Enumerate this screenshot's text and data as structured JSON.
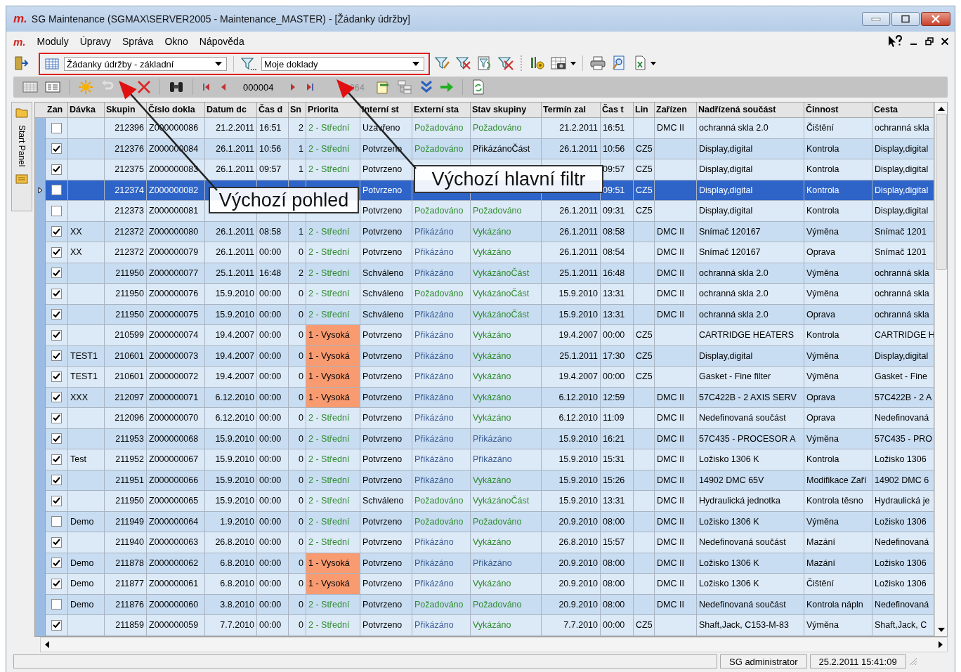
{
  "window": {
    "logo": "m.",
    "title": "SG Maintenance (SGMAX\\SERVER2005 - Maintenance_MASTER) - [Žádanky údržby]"
  },
  "menu": {
    "logo": "m.",
    "items": [
      "Moduly",
      "Úpravy",
      "Správa",
      "Okno",
      "Nápověda"
    ]
  },
  "toolbar": {
    "view": "Žádanky údržby - základní",
    "filter": "Moje doklady"
  },
  "navigator": {
    "record": "000004",
    "count": "064"
  },
  "side_panel": {
    "label": "Start Panel"
  },
  "callouts": [
    "Výchozí pohled",
    "Výchozí hlavní filtr"
  ],
  "table": {
    "checkbox_column": "Zan",
    "columns": [
      "Dávka",
      "Skupin",
      "Číslo dokla",
      "Datum dc",
      "Čas d",
      "Sn",
      "Priorita",
      "Interní st",
      "Externí sta",
      "Stav skupiny",
      "Termín zal",
      "Čas t",
      "Lin",
      "Zařízen",
      "Nadřízená součást",
      "Činnost",
      "Cesta"
    ],
    "rows": [
      {
        "checked": false,
        "selected": false,
        "cells": [
          "",
          "212396",
          "Z000000086",
          "21.2.2011",
          "16:51",
          "2",
          {
            "text": "2 - Střední",
            "kind": "medium"
          },
          "Uzavřeno",
          {
            "text": "Požadováno",
            "color": "#2e8b2e"
          },
          {
            "text": "Požadováno",
            "color": "#2e8b2e"
          },
          "21.2.2011",
          "16:51",
          "",
          "DMC II",
          "ochranná skla  2.0",
          "Čištění",
          "ochranná skla"
        ]
      },
      {
        "checked": true,
        "selected": false,
        "cells": [
          "",
          "212376",
          "Z000000084",
          "26.1.2011",
          "10:56",
          "1",
          {
            "text": "2 - Střední",
            "kind": "medium"
          },
          "Potvrzeno",
          {
            "text": "Požadováno",
            "color": "#2e8b2e"
          },
          {
            "text": "PřikázánoČást",
            "color": "#000000"
          },
          "26.1.2011",
          "10:56",
          "CZ5",
          "",
          "Display,digital",
          "Kontrola",
          "Display,digital"
        ]
      },
      {
        "checked": true,
        "selected": false,
        "cells": [
          "",
          "212375",
          "Z000000083",
          "26.1.2011",
          "09:57",
          "1",
          {
            "text": "2 - Střední",
            "kind": "medium"
          },
          "Potvrzeno",
          "",
          "",
          "",
          "09:57",
          "CZ5",
          "",
          "Display,digital",
          "Kontrola",
          "Display,digital"
        ]
      },
      {
        "checked": false,
        "selected": true,
        "cells": [
          "",
          "212374",
          "Z000000082",
          "",
          "",
          "",
          "",
          "Potvrzeno",
          "",
          "",
          "",
          "09:51",
          "CZ5",
          "",
          "Display,digital",
          "Kontrola",
          "Display,digital"
        ]
      },
      {
        "checked": false,
        "selected": false,
        "cells": [
          "",
          "212373",
          "Z000000081",
          "",
          "",
          "",
          "",
          "Potvrzeno",
          {
            "text": "Požadováno",
            "color": "#2e8b2e"
          },
          {
            "text": "Požadováno",
            "color": "#2e8b2e"
          },
          "26.1.2011",
          "09:31",
          "CZ5",
          "",
          "Display,digital",
          "Kontrola",
          "Display,digital"
        ]
      },
      {
        "checked": true,
        "selected": false,
        "cells": [
          "XX",
          "212372",
          "Z000000080",
          "26.1.2011",
          "08:58",
          "1",
          {
            "text": "2 - Střední",
            "kind": "medium"
          },
          "Potvrzeno",
          {
            "text": "Přikázáno",
            "color": "#3b5b92"
          },
          {
            "text": "Vykázáno",
            "color": "#2e8b2e"
          },
          "26.1.2011",
          "08:58",
          "",
          "DMC II",
          "Snímač  120167",
          "Výměna",
          "Snímač  1201"
        ]
      },
      {
        "checked": true,
        "selected": false,
        "cells": [
          "XX",
          "212372",
          "Z000000079",
          "26.1.2011",
          "00:00",
          "0",
          {
            "text": "2 - Střední",
            "kind": "medium"
          },
          "Potvrzeno",
          {
            "text": "Přikázáno",
            "color": "#3b5b92"
          },
          {
            "text": "Vykázáno",
            "color": "#2e8b2e"
          },
          "26.1.2011",
          "08:54",
          "",
          "DMC II",
          "Snímač  120167",
          "Oprava",
          "Snímač  1201"
        ]
      },
      {
        "checked": true,
        "selected": false,
        "cells": [
          "",
          "211950",
          "Z000000077",
          "25.1.2011",
          "16:48",
          "2",
          {
            "text": "2 - Střední",
            "kind": "medium"
          },
          "Schváleno",
          {
            "text": "Přikázáno",
            "color": "#3b5b92"
          },
          {
            "text": "VykázánoČást",
            "color": "#2e8b2e"
          },
          "25.1.2011",
          "16:48",
          "",
          "DMC II",
          "ochranná skla  2.0",
          "Výměna",
          "ochranná skla"
        ]
      },
      {
        "checked": true,
        "selected": false,
        "cells": [
          "",
          "211950",
          "Z000000076",
          "15.9.2010",
          "00:00",
          "0",
          {
            "text": "2 - Střední",
            "kind": "medium"
          },
          "Schváleno",
          {
            "text": "Požadováno",
            "color": "#2e8b2e"
          },
          {
            "text": "VykázánoČást",
            "color": "#2e8b2e"
          },
          "15.9.2010",
          "13:31",
          "",
          "DMC II",
          "ochranná skla  2.0",
          "Výměna",
          "ochranná skla"
        ]
      },
      {
        "checked": true,
        "selected": false,
        "cells": [
          "",
          "211950",
          "Z000000075",
          "15.9.2010",
          "00:00",
          "0",
          {
            "text": "2 - Střední",
            "kind": "medium"
          },
          "Schváleno",
          {
            "text": "Přikázáno",
            "color": "#3b5b92"
          },
          {
            "text": "VykázánoČást",
            "color": "#2e8b2e"
          },
          "15.9.2010",
          "13:31",
          "",
          "DMC II",
          "ochranná skla  2.0",
          "Oprava",
          "ochranná skla"
        ]
      },
      {
        "checked": true,
        "selected": false,
        "cells": [
          "",
          "210599",
          "Z000000074",
          "19.4.2007",
          "00:00",
          "0",
          {
            "text": "1 - Vysoká",
            "kind": "high"
          },
          "Potvrzeno",
          {
            "text": "Přikázáno",
            "color": "#3b5b92"
          },
          {
            "text": "Vykázáno",
            "color": "#2e8b2e"
          },
          "19.4.2007",
          "00:00",
          "CZ5",
          "",
          "CARTRIDGE HEATERS",
          "Kontrola",
          "CARTRIDGE H"
        ]
      },
      {
        "checked": true,
        "selected": false,
        "cells": [
          "TEST1",
          "210601",
          "Z000000073",
          "19.4.2007",
          "00:00",
          "0",
          {
            "text": "1 - Vysoká",
            "kind": "high"
          },
          "Potvrzeno",
          {
            "text": "Přikázáno",
            "color": "#3b5b92"
          },
          {
            "text": "Vykázáno",
            "color": "#2e8b2e"
          },
          "25.1.2011",
          "17:30",
          "CZ5",
          "",
          "Display,digital",
          "Výměna",
          "Display,digital"
        ]
      },
      {
        "checked": true,
        "selected": false,
        "cells": [
          "TEST1",
          "210601",
          "Z000000072",
          "19.4.2007",
          "00:00",
          "0",
          {
            "text": "1 - Vysoká",
            "kind": "high"
          },
          "Potvrzeno",
          {
            "text": "Přikázáno",
            "color": "#3b5b92"
          },
          {
            "text": "Vykázáno",
            "color": "#2e8b2e"
          },
          "19.4.2007",
          "00:00",
          "CZ5",
          "",
          "Gasket - Fine filter",
          "Výměna",
          "Gasket - Fine"
        ]
      },
      {
        "checked": true,
        "selected": false,
        "cells": [
          "XXX",
          "212097",
          "Z000000071",
          "6.12.2010",
          "00:00",
          "0",
          {
            "text": "1 - Vysoká",
            "kind": "high"
          },
          "Potvrzeno",
          {
            "text": "Přikázáno",
            "color": "#3b5b92"
          },
          {
            "text": "Vykázáno",
            "color": "#2e8b2e"
          },
          "6.12.2010",
          "12:59",
          "",
          "DMC II",
          "57C422B - 2 AXIS SERV",
          "Oprava",
          "57C422B - 2 A"
        ]
      },
      {
        "checked": true,
        "selected": false,
        "cells": [
          "",
          "212096",
          "Z000000070",
          "6.12.2010",
          "00:00",
          "0",
          {
            "text": "2 - Střední",
            "kind": "medium"
          },
          "Potvrzeno",
          {
            "text": "Přikázáno",
            "color": "#3b5b92"
          },
          {
            "text": "Vykázáno",
            "color": "#2e8b2e"
          },
          "6.12.2010",
          "11:09",
          "",
          "DMC II",
          "Nedefinovaná součást",
          "Oprava",
          "Nedefinovaná"
        ]
      },
      {
        "checked": true,
        "selected": false,
        "cells": [
          "",
          "211953",
          "Z000000068",
          "15.9.2010",
          "00:00",
          "0",
          {
            "text": "2 - Střední",
            "kind": "medium"
          },
          "Potvrzeno",
          {
            "text": "Přikázáno",
            "color": "#3b5b92"
          },
          {
            "text": "Přikázáno",
            "color": "#3b5b92"
          },
          "15.9.2010",
          "16:21",
          "",
          "DMC II",
          "57C435 - PROCESOR  A",
          "Výměna",
          "57C435 - PRO"
        ]
      },
      {
        "checked": true,
        "selected": false,
        "cells": [
          "Test",
          "211952",
          "Z000000067",
          "15.9.2010",
          "00:00",
          "0",
          {
            "text": "2 - Střední",
            "kind": "medium"
          },
          "Potvrzeno",
          {
            "text": "Přikázáno",
            "color": "#3b5b92"
          },
          {
            "text": "Přikázáno",
            "color": "#3b5b92"
          },
          "15.9.2010",
          "15:31",
          "",
          "DMC II",
          "Ložisko 1306 K",
          "Kontrola",
          "Ložisko 1306"
        ]
      },
      {
        "checked": true,
        "selected": false,
        "cells": [
          "",
          "211951",
          "Z000000066",
          "15.9.2010",
          "00:00",
          "0",
          {
            "text": "2 - Střední",
            "kind": "medium"
          },
          "Potvrzeno",
          {
            "text": "Přikázáno",
            "color": "#3b5b92"
          },
          {
            "text": "Vykázáno",
            "color": "#2e8b2e"
          },
          "15.9.2010",
          "15:26",
          "",
          "DMC II",
          "14902 DMC 65V",
          "Modifikace Zaří",
          "14902 DMC 6"
        ]
      },
      {
        "checked": true,
        "selected": false,
        "cells": [
          "",
          "211950",
          "Z000000065",
          "15.9.2010",
          "00:00",
          "0",
          {
            "text": "2 - Střední",
            "kind": "medium"
          },
          "Schváleno",
          {
            "text": "Požadováno",
            "color": "#2e8b2e"
          },
          {
            "text": "VykázánoČást",
            "color": "#2e8b2e"
          },
          "15.9.2010",
          "13:31",
          "",
          "DMC II",
          "Hydraulická jednotka",
          "Kontrola těsno",
          "Hydraulická je"
        ]
      },
      {
        "checked": false,
        "selected": false,
        "cells": [
          "Demo",
          "211949",
          "Z000000064",
          "1.9.2010",
          "00:00",
          "0",
          {
            "text": "2 - Střední",
            "kind": "medium"
          },
          "Potvrzeno",
          {
            "text": "Požadováno",
            "color": "#2e8b2e"
          },
          {
            "text": "Požadováno",
            "color": "#2e8b2e"
          },
          "20.9.2010",
          "08:00",
          "",
          "DMC II",
          "Ložisko 1306 K",
          "Výměna",
          "Ložisko 1306"
        ]
      },
      {
        "checked": true,
        "selected": false,
        "cells": [
          "",
          "211940",
          "Z000000063",
          "26.8.2010",
          "00:00",
          "0",
          {
            "text": "2 - Střední",
            "kind": "medium"
          },
          "Potvrzeno",
          {
            "text": "Přikázáno",
            "color": "#3b5b92"
          },
          {
            "text": "Vykázáno",
            "color": "#2e8b2e"
          },
          "26.8.2010",
          "15:57",
          "",
          "DMC II",
          "Nedefinovaná součást",
          "Mazání",
          "Nedefinovaná"
        ]
      },
      {
        "checked": true,
        "selected": false,
        "cells": [
          "Demo",
          "211878",
          "Z000000062",
          "6.8.2010",
          "00:00",
          "0",
          {
            "text": "1 - Vysoká",
            "kind": "high"
          },
          "Potvrzeno",
          {
            "text": "Přikázáno",
            "color": "#3b5b92"
          },
          {
            "text": "Přikázáno",
            "color": "#3b5b92"
          },
          "20.9.2010",
          "08:00",
          "",
          "DMC II",
          "Ložisko 1306 K",
          "Mazání",
          "Ložisko 1306"
        ]
      },
      {
        "checked": true,
        "selected": false,
        "cells": [
          "Demo",
          "211877",
          "Z000000061",
          "6.8.2010",
          "00:00",
          "0",
          {
            "text": "1 - Vysoká",
            "kind": "high"
          },
          "Potvrzeno",
          {
            "text": "Přikázáno",
            "color": "#3b5b92"
          },
          {
            "text": "Vykázáno",
            "color": "#2e8b2e"
          },
          "20.9.2010",
          "08:00",
          "",
          "DMC II",
          "Ložisko 1306 K",
          "Čištění",
          "Ložisko 1306"
        ]
      },
      {
        "checked": false,
        "selected": false,
        "cells": [
          "Demo",
          "211876",
          "Z000000060",
          "3.8.2010",
          "00:00",
          "0",
          {
            "text": "2 - Střední",
            "kind": "medium"
          },
          "Potvrzeno",
          {
            "text": "Požadováno",
            "color": "#2e8b2e"
          },
          {
            "text": "Požadováno",
            "color": "#2e8b2e"
          },
          "20.9.2010",
          "08:00",
          "",
          "DMC II",
          "Nedefinovaná součást",
          "Kontrola nápln",
          "Nedefinovaná"
        ]
      },
      {
        "checked": true,
        "selected": false,
        "cells": [
          "",
          "211859",
          "Z000000059",
          "7.7.2010",
          "00:00",
          "0",
          {
            "text": "2 - Střední",
            "kind": "medium"
          },
          "Potvrzeno",
          {
            "text": "Přikázáno",
            "color": "#3b5b92"
          },
          {
            "text": "Vykázáno",
            "color": "#2e8b2e"
          },
          "7.7.2010",
          "00:00",
          "CZ5",
          "",
          "Shaft,Jack, C153-M-83",
          "Výměna",
          "Shaft,Jack, C"
        ]
      }
    ]
  },
  "status_bar": {
    "user": "SG administrator",
    "datetime": "25.2.2011 15:41:09"
  }
}
